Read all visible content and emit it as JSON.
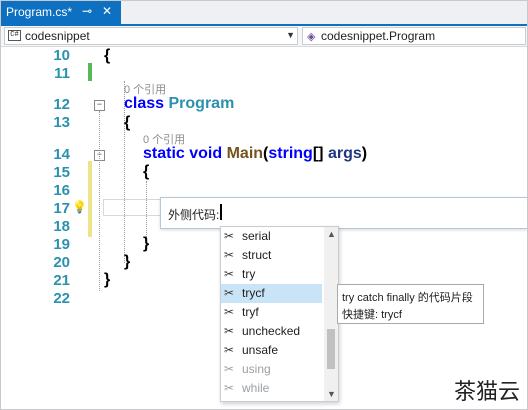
{
  "tab": {
    "title": "Program.cs*",
    "pin_icon": "pin-icon",
    "close_icon": "close-icon"
  },
  "nav": {
    "left_text": "codesnippet",
    "right_text": "codesnippet.Program"
  },
  "code": {
    "lines": [
      {
        "n": "10",
        "text": "{"
      },
      {
        "n": "11",
        "text": ""
      },
      {
        "n": "12",
        "text": "class Program"
      },
      {
        "n": "13",
        "text": "{"
      },
      {
        "n": "14",
        "text": "static void Main(string[] args)"
      },
      {
        "n": "15",
        "text": "{"
      },
      {
        "n": "16",
        "text": ""
      },
      {
        "n": "17",
        "text": ""
      },
      {
        "n": "18",
        "text": ""
      },
      {
        "n": "19",
        "text": "}"
      },
      {
        "n": "20",
        "text": "}"
      },
      {
        "n": "21",
        "text": "}"
      },
      {
        "n": "22",
        "text": ""
      }
    ],
    "refs1": "0 个引用",
    "refs2": "0 个引用",
    "tokens": {
      "class_kw": "class",
      "class_name": "Program",
      "static_kw": "static",
      "void_kw": "void",
      "main_fn": "Main",
      "paren_open": "(",
      "string_kw": "string",
      "brackets": "[]",
      "args": "args",
      "paren_close": ")"
    }
  },
  "snippet_input": {
    "label": "外侧代码:",
    "value": ""
  },
  "completion": {
    "items": [
      {
        "label": "serial",
        "selected": false,
        "faded": false
      },
      {
        "label": "struct",
        "selected": false,
        "faded": false
      },
      {
        "label": "try",
        "selected": false,
        "faded": false
      },
      {
        "label": "trycf",
        "selected": true,
        "faded": false
      },
      {
        "label": "tryf",
        "selected": false,
        "faded": false
      },
      {
        "label": "unchecked",
        "selected": false,
        "faded": false
      },
      {
        "label": "unsafe",
        "selected": false,
        "faded": false
      },
      {
        "label": "using",
        "selected": false,
        "faded": true
      },
      {
        "label": "while",
        "selected": false,
        "faded": true
      }
    ],
    "item_icon": "snippet-icon"
  },
  "tooltip": {
    "line1": "try catch finally 的代码片段",
    "line2": "快捷键: trycf"
  },
  "watermark": "茶猫云",
  "colors": {
    "accent": "#0e70c0",
    "keyword": "#0000ff",
    "type": "#2b91af",
    "method": "#74531f",
    "param": "#1f377f",
    "selection": "#c9e4f7"
  }
}
